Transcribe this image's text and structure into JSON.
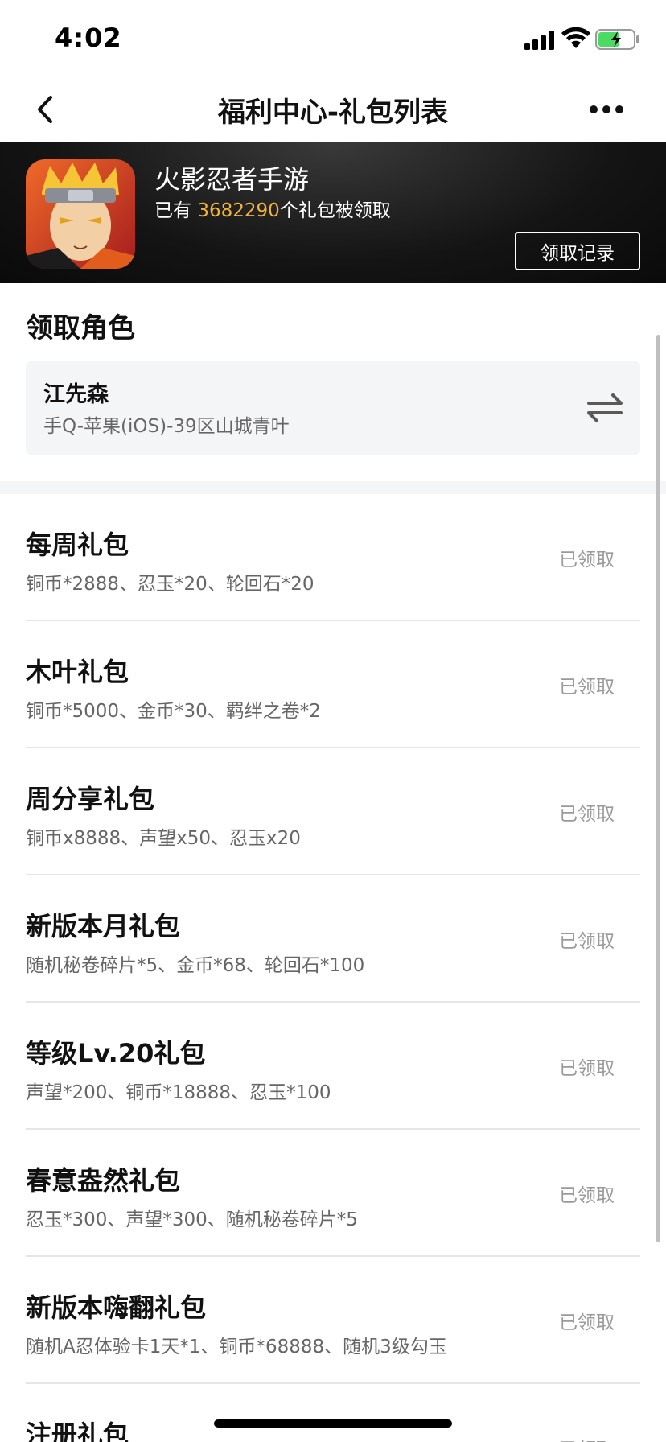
{
  "status_bar": {
    "time": "4:02",
    "icons": [
      "signal-icon",
      "wifi-icon",
      "battery-charging-icon"
    ],
    "battery_color": "#4cd964"
  },
  "nav": {
    "title": "福利中心-礼包列表",
    "back_icon": "chevron-left-icon",
    "more_icon": "more-dots-icon"
  },
  "header": {
    "game_name": "火影忍者手游",
    "claimed_prefix": "已有 ",
    "claimed_count": "3682290",
    "claimed_suffix": "个礼包被领取",
    "records_button": "领取记录",
    "count_color": "#f5b339"
  },
  "role": {
    "section_title": "领取角色",
    "name": "江先森",
    "server": "手Q-苹果(iOS)-39区山城青叶",
    "switch_icon": "swap-arrows-icon"
  },
  "gifts": [
    {
      "name": "每周礼包",
      "desc": "铜币*2888、忍玉*20、轮回石*20",
      "status": "已领取"
    },
    {
      "name": "木叶礼包",
      "desc": "铜币*5000、金币*30、羁绊之卷*2",
      "status": "已领取"
    },
    {
      "name": "周分享礼包",
      "desc": "铜币x8888、声望x50、忍玉x20",
      "status": "已领取"
    },
    {
      "name": "新版本月礼包",
      "desc": "随机秘卷碎片*5、金币*68、轮回石*100",
      "status": "已领取"
    },
    {
      "name": "等级Lv.20礼包",
      "desc": "声望*200、铜币*18888、忍玉*100",
      "status": "已领取"
    },
    {
      "name": "春意盎然礼包",
      "desc": "忍玉*300、声望*300、随机秘卷碎片*5",
      "status": "已领取"
    },
    {
      "name": "新版本嗨翻礼包",
      "desc": "随机A忍体验卡1天*1、铜币*68888、随机3级勾玉",
      "status": "已领取"
    },
    {
      "name": "注册礼包",
      "desc": "",
      "status": "已领取"
    }
  ]
}
